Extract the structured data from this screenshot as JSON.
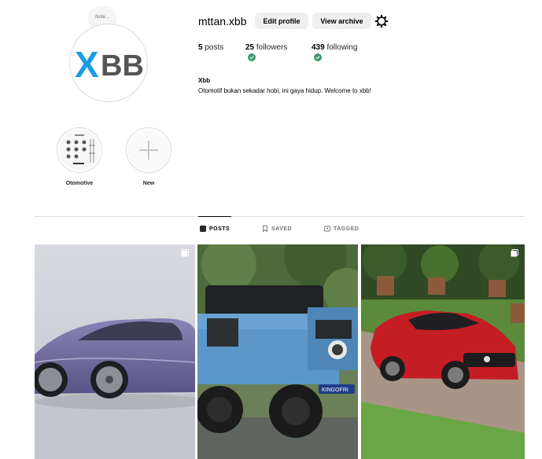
{
  "profile": {
    "note_text": "Note...",
    "avatar_text": "XBB",
    "username": "mttan.xbb",
    "edit_label": "Edit profile",
    "archive_label": "View archive",
    "stats": {
      "posts_count": "5",
      "posts_label": "posts",
      "followers_count": "25",
      "followers_label": "followers",
      "following_count": "439",
      "following_label": "following"
    },
    "bio_name": "Xbb",
    "bio_text": "Otomotif bukan sekadar hobi, ini gaya hidup. Welcome to xbb!"
  },
  "highlights": [
    {
      "label": "Otomotive"
    },
    {
      "label": "New"
    }
  ],
  "tabs": [
    {
      "label": "POSTS",
      "active": true
    },
    {
      "label": "SAVED",
      "active": false
    },
    {
      "label": "TAGGED",
      "active": false
    }
  ],
  "posts": [
    {
      "subject": "purple electric sedan",
      "multi": true
    },
    {
      "subject": "blue off-road 4x4",
      "plate_text": "KINGOFRI",
      "multi": false
    },
    {
      "subject": "red coupe in garden",
      "multi": true
    }
  ],
  "colors": {
    "accent_check": "#3d9970",
    "logo_blue": "#1a9be6",
    "logo_gray": "#555555",
    "button_bg": "#efefef"
  }
}
